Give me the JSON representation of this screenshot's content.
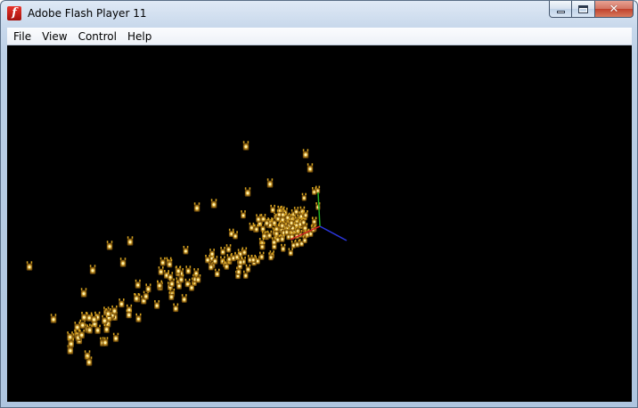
{
  "window": {
    "title": "Adobe Flash Player 11",
    "icon": "flash-player-icon",
    "controls": {
      "minimize": "minimize-icon",
      "maximize": "maximize-icon",
      "close": "close-icon"
    }
  },
  "menu": {
    "items": [
      {
        "label": "File"
      },
      {
        "label": "View"
      },
      {
        "label": "Control"
      },
      {
        "label": "Help"
      }
    ]
  },
  "stage": {
    "background": "#000000",
    "particle_color": "#d4a01e",
    "particle_glow": "#fff3b0",
    "axis_colors": {
      "x": "#2a35d8",
      "y": "#21b021",
      "z": "#d02020"
    }
  },
  "controls_glyph": {
    "close": "✕"
  }
}
